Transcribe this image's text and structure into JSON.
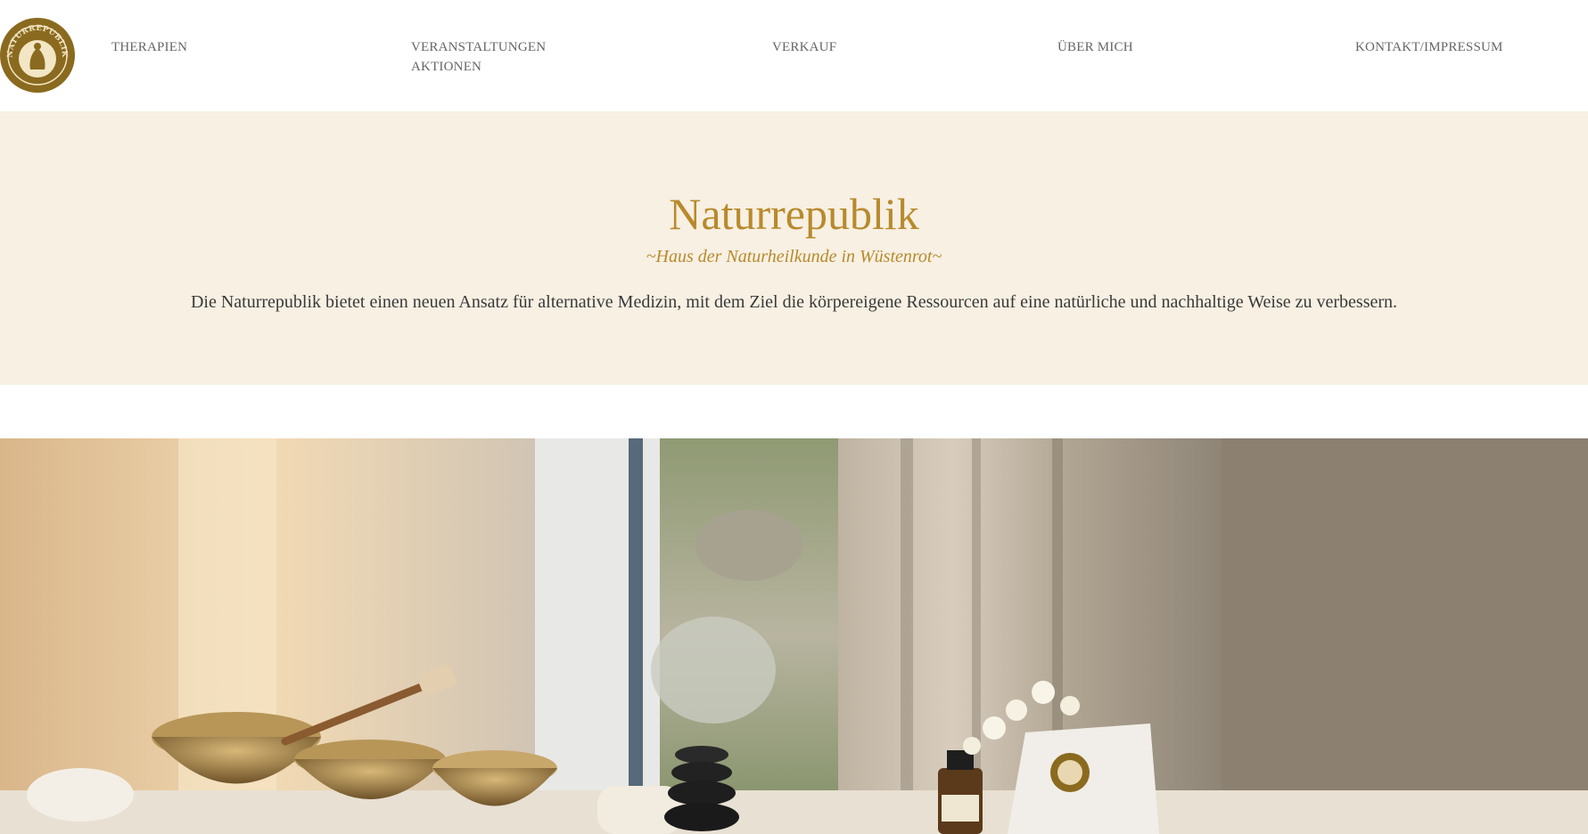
{
  "brand": {
    "logo_text": "NATURREPUBLIK",
    "color_gold": "#b88a2c",
    "color_logo": "#8a6a1f",
    "color_hero_bg": "#f7f0e3"
  },
  "nav": {
    "items": [
      {
        "lines": [
          "THERAPIEN"
        ]
      },
      {
        "lines": [
          "VERANSTALTUNGEN",
          "AKTIONEN"
        ]
      },
      {
        "lines": [
          "VERKAUF"
        ]
      },
      {
        "lines": [
          "ÜBER MICH"
        ]
      },
      {
        "lines": [
          "KONTAKT/IMPRESSUM"
        ]
      }
    ]
  },
  "hero": {
    "title": "Naturrepublik",
    "subtitle": "~Haus der Naturheilkunde in Wüstenrot~",
    "text": "Die Naturrepublik bietet einen neuen Ansatz für alternative Medizin, mit dem Ziel die körpereigene Ressourcen auf eine natürliche und nachhaltige Weise zu verbessern."
  }
}
